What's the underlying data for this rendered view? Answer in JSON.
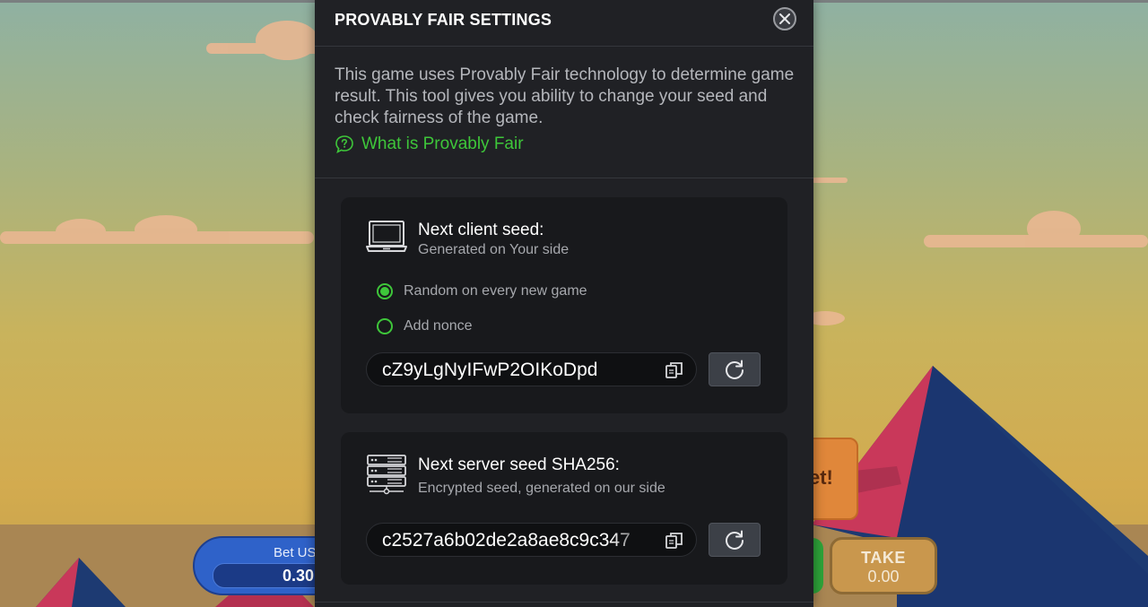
{
  "modal": {
    "title": "PROVABLY FAIR SETTINGS",
    "intro": "This game uses Provably Fair technology to determine game result. This tool gives you ability to change your seed and check fairness of the game.",
    "link_label": "What is Provably Fair",
    "close_icon": "close-icon"
  },
  "client_seed": {
    "title": "Next client seed:",
    "subtitle": "Generated on Your side",
    "icon": "laptop-icon",
    "options": [
      {
        "label": "Random on every new game",
        "selected": true
      },
      {
        "label": "Add nonce",
        "selected": false
      }
    ],
    "value": "cZ9yLgNyIFwP2OIKoDpd"
  },
  "server_seed": {
    "title": "Next server seed SHA256:",
    "subtitle": "Encrypted seed, generated on our side",
    "icon": "server-icon",
    "value": "c2527a6b02de2a8ae8c9c347"
  },
  "game": {
    "bet_label": "Bet US",
    "bet_value": "0.30",
    "take_label": "TAKE",
    "take_value": "0.00",
    "bubble_text": "et!"
  },
  "colors": {
    "accent": "#3ec63a",
    "modal_bg": "#202125",
    "card_bg": "#18191c"
  }
}
